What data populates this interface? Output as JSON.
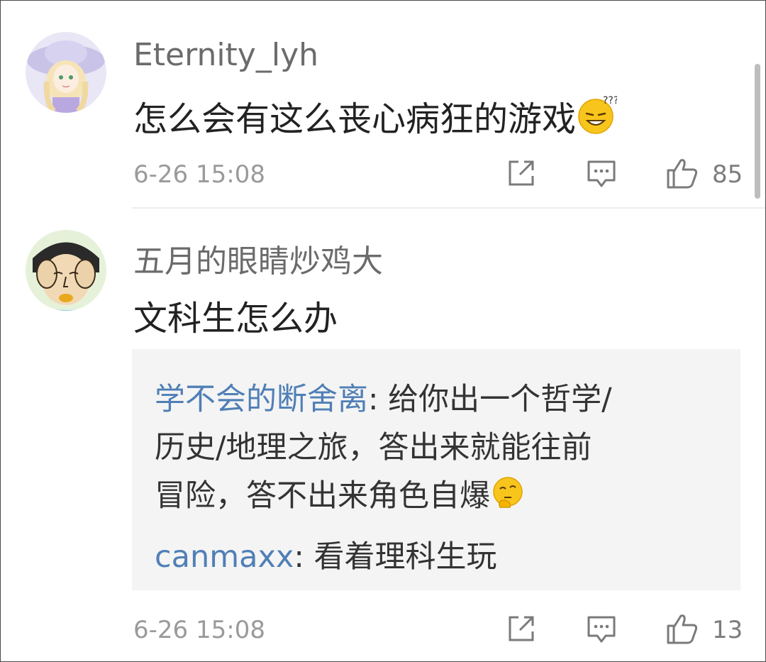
{
  "comments": [
    {
      "username": "Eternity_lyh",
      "content": "怎么会有这么丧心病狂的游戏",
      "emoji": "sweat-smile-emoji",
      "time": "6-26 15:08",
      "likes": "85"
    },
    {
      "username": "五月的眼睛炒鸡大",
      "content": "文科生怎么办",
      "time": "6-26 15:08",
      "likes": "13",
      "replies": [
        {
          "user": "学不会的断舍离",
          "sep": ": ",
          "lines": [
            "给你出一个哲学/",
            "历史/地理之旅，答出来就能往前",
            "冒险，答不出来角色自爆"
          ],
          "emoji": "thinking-emoji"
        },
        {
          "user": "canmaxx",
          "sep": ": ",
          "lines": [
            "看着理科生玩"
          ]
        }
      ]
    }
  ],
  "icons": {
    "share": "share-icon",
    "reply": "comment-icon",
    "like": "thumbs-up-icon"
  },
  "colors": {
    "reply_user": "#4f7fb6",
    "reply_bg": "#f4f4f4"
  }
}
